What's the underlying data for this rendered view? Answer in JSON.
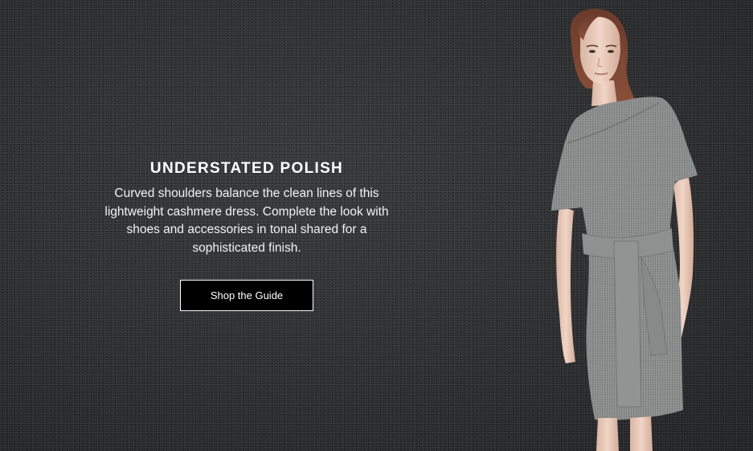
{
  "hero": {
    "headline": "UNDERSTATED POLISH",
    "body": "Curved shoulders balance the clean lines of this lightweight cashmere dress. Complete the look with shoes and accessories in tonal shared for a sophisticated finish.",
    "cta_label": "Shop the Guide"
  },
  "colors": {
    "background": "#2b2c2e",
    "text": "#ffffff",
    "button_bg": "#000000",
    "button_border": "#ffffff",
    "dress": "#8c8f8d"
  },
  "image": {
    "subject": "model-in-grey-dress"
  }
}
